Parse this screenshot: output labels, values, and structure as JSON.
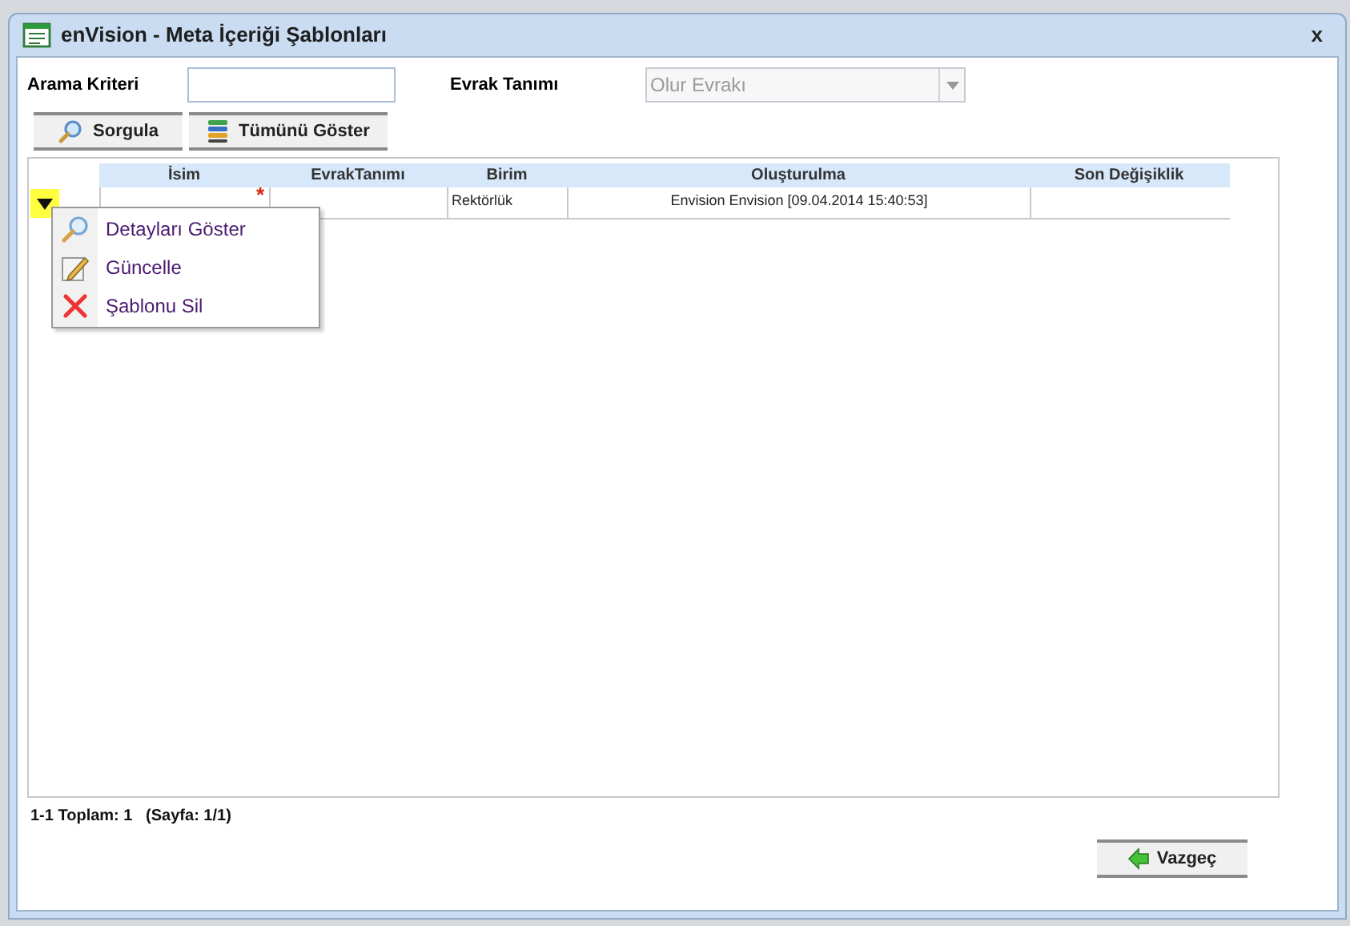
{
  "window": {
    "title": "enVision - Meta İçeriği Şablonları",
    "close": "x"
  },
  "search": {
    "criteria_label": "Arama Kriteri",
    "type_label": "Evrak Tanımı",
    "type_value": "Olur Evrakı",
    "type_disabled": true
  },
  "buttons": [
    {
      "kind": "search",
      "label": "Sorgula"
    },
    {
      "kind": "list",
      "label": "Tümünü Göster"
    }
  ],
  "table": {
    "columns": [
      "İsim",
      "EvrakTanımı",
      "Birim",
      "Oluşturulma",
      "Son Değişiklik"
    ],
    "rows": [
      {
        "cells": [
          null,
          null,
          "Rektörlük",
          "Envision Envision [09.04.2014 15:40:53]",
          null
        ],
        "required_mark": "*"
      }
    ]
  },
  "context_menu": {
    "items": [
      {
        "kind": "details",
        "label": "Detayları Göster"
      },
      {
        "kind": "edit",
        "label": "Güncelle"
      },
      {
        "kind": "delete",
        "label": "Şablonu Sil"
      }
    ]
  },
  "status": "1-1 Toplam: 1   (Sayfa: 1/1)",
  "cancel_button": "Vazgeç"
}
